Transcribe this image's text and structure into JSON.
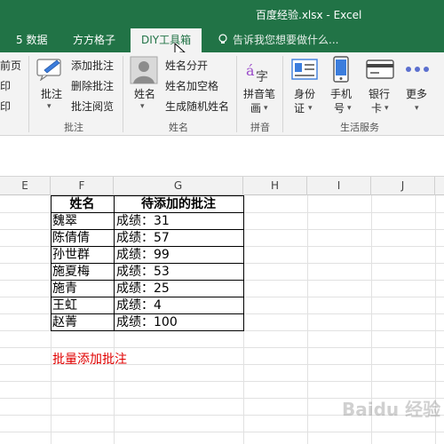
{
  "window": {
    "title": "百度经验.xlsx - Excel"
  },
  "tabs": {
    "data": "5 数据",
    "grid": "方方格子",
    "diy": "DIY工具箱"
  },
  "tell_me": "告诉我您想要做什么...",
  "ribbon": {
    "left_cut": {
      "a": "前页",
      "b": "印",
      "c": "印"
    },
    "comment": {
      "big_label": "批注",
      "add": "添加批注",
      "delete": "删除批注",
      "read": "批注阅览",
      "group": "批注"
    },
    "name": {
      "big_label": "姓名",
      "split": "姓名分开",
      "add_space": "姓名加空格",
      "random": "生成随机姓名",
      "group": "姓名"
    },
    "pinyin": {
      "big_label_1": "拼音笔",
      "big_label_2": "画",
      "group": "拼音"
    },
    "life": {
      "id_1": "身份",
      "id_2": "证",
      "phone_1": "手机",
      "phone_2": "号",
      "bank_1": "银行",
      "bank_2": "卡",
      "more": "更多",
      "group": "生活服务"
    }
  },
  "columns": [
    "E",
    "F",
    "G",
    "H",
    "I",
    "J"
  ],
  "table": {
    "headers": [
      "姓名",
      "待添加的批注"
    ],
    "rows": [
      [
        "魏翠",
        "成绩：31"
      ],
      [
        "陈倩倩",
        "成绩：57"
      ],
      [
        "孙世群",
        "成绩：99"
      ],
      [
        "施夏梅",
        "成绩：53"
      ],
      [
        "施青",
        "成绩：25"
      ],
      [
        "王虹",
        "成绩：4"
      ],
      [
        "赵菁",
        "成绩：100"
      ]
    ]
  },
  "note": "批量添加批注",
  "watermark": "Baidu 经验",
  "colors": {
    "excel_green": "#217346",
    "note_red": "#e00000"
  }
}
